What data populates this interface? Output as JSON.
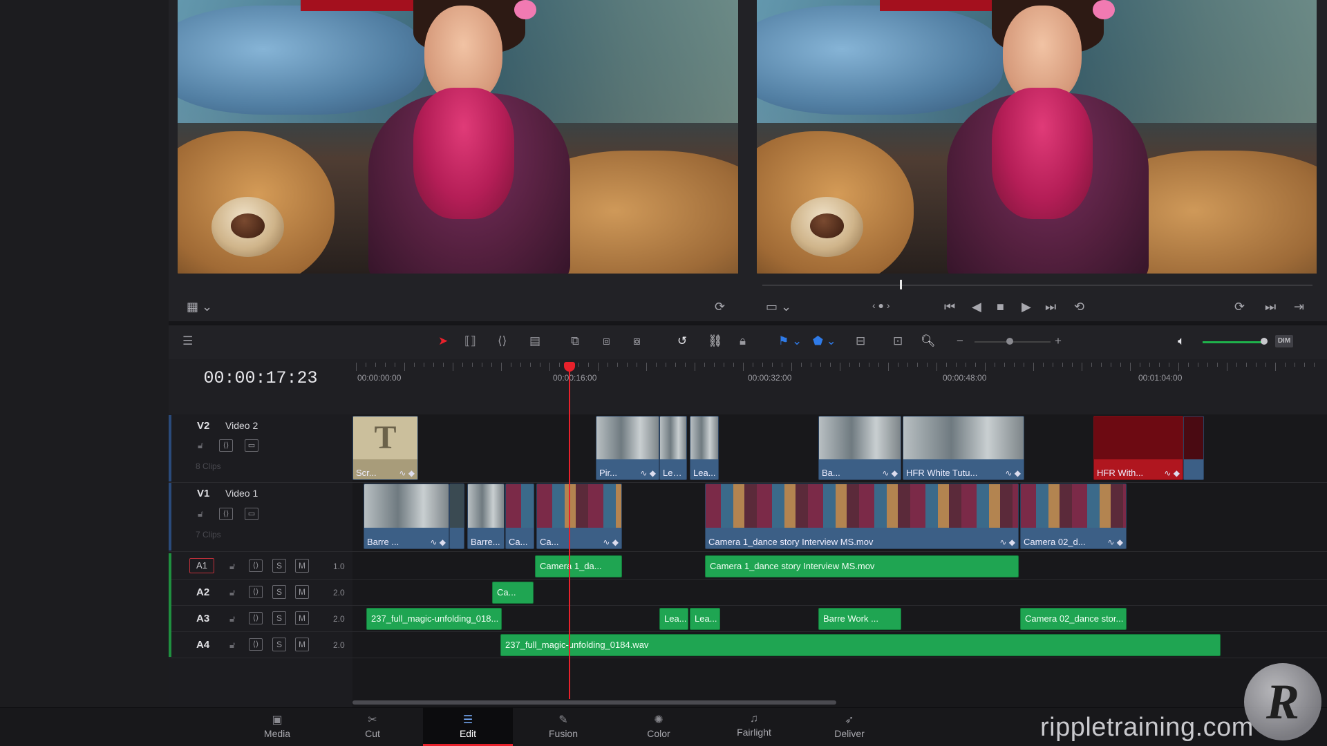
{
  "timeline": {
    "timecode": "00:00:17:23",
    "ruler": [
      "00:00:00:00",
      "00:00:16:00",
      "00:00:32:00",
      "00:00:48:00",
      "00:01:04:00"
    ]
  },
  "tracks": {
    "video": [
      {
        "id": "V2",
        "name": "Video 2",
        "clips_count": "8 Clips"
      },
      {
        "id": "V1",
        "name": "Video 1",
        "clips_count": "7 Clips"
      }
    ],
    "audio": [
      {
        "id": "A1",
        "volume": "1.0"
      },
      {
        "id": "A2",
        "volume": "2.0"
      },
      {
        "id": "A3",
        "volume": "2.0"
      },
      {
        "id": "A4",
        "volume": "2.0"
      }
    ],
    "solo_label": "S",
    "mute_label": "M"
  },
  "clips": {
    "v2": [
      "Scr...",
      "Pir...",
      "Lea...",
      "Lea...",
      "Ba...",
      "HFR White Tutu...",
      "HFR With..."
    ],
    "v1": [
      "Barre ...",
      "Barre...",
      "Ca...",
      "Ca...",
      "Camera 1_dance story Interview MS.mov",
      "Camera 02_d..."
    ],
    "a1": [
      "Camera 1_da...",
      "Camera 1_dance story Interview MS.mov"
    ],
    "a2": [
      "Ca..."
    ],
    "a3": [
      "237_full_magic-unfolding_018...",
      "Lea...",
      "Lea...",
      "Barre Work ...",
      "Camera 02_dance stor..."
    ],
    "a4": [
      "237_full_magic-unfolding_0184.wav"
    ]
  },
  "toolbar": {
    "dim_label": "DIM"
  },
  "pages": [
    {
      "label": "Media",
      "icon": "media-icon"
    },
    {
      "label": "Cut",
      "icon": "cut-icon"
    },
    {
      "label": "Edit",
      "icon": "edit-icon",
      "active": true
    },
    {
      "label": "Fusion",
      "icon": "fusion-icon"
    },
    {
      "label": "Color",
      "icon": "color-icon"
    },
    {
      "label": "Fairlight",
      "icon": "fairlight-icon"
    },
    {
      "label": "Deliver",
      "icon": "deliver-icon"
    }
  ],
  "watermark": {
    "text": "rippletraining.com",
    "logo": "R"
  },
  "colors": {
    "playhead": "#e8212b",
    "video_clip": "#3c5f86",
    "audio_clip": "#1fa552",
    "accent_red_clip": "#b0161f"
  }
}
